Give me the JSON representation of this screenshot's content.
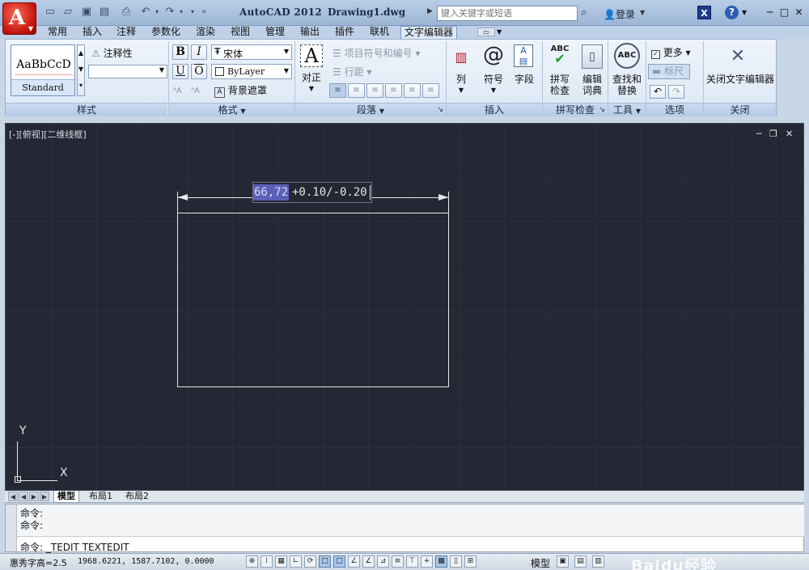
{
  "app": {
    "title": "AutoCAD 2012",
    "document": "Drawing1.dwg",
    "search_placeholder": "键入关键字或短语",
    "login_label": "登录"
  },
  "tabs": [
    {
      "label": "常用"
    },
    {
      "label": "插入"
    },
    {
      "label": "注释"
    },
    {
      "label": "参数化"
    },
    {
      "label": "渲染"
    },
    {
      "label": "视图"
    },
    {
      "label": "管理"
    },
    {
      "label": "输出"
    },
    {
      "label": "插件"
    },
    {
      "label": "联机"
    },
    {
      "label": "文字编辑器",
      "active": true
    }
  ],
  "ribbon": {
    "style": {
      "sample_text": "AaBbCcD",
      "style_name": "Standard",
      "annotative_label": "注释性",
      "height_value": "",
      "panel_title": "样式"
    },
    "format": {
      "bold": "B",
      "italic": "I",
      "underline": "U",
      "overline": "O",
      "font_value": "宋体",
      "color_value": "ByLayer",
      "mask_label": "背景遮罩",
      "panel_title": "格式"
    },
    "paragraph": {
      "justify_label": "对正",
      "bullets_label": "项目符号和编号",
      "spacing_label": "行距",
      "panel_title": "段落"
    },
    "insert": {
      "columns_label": "列",
      "symbol_label": "符号",
      "field_label": "字段",
      "panel_title": "插入"
    },
    "spell": {
      "spellcheck_label_1": "拼写",
      "spellcheck_label_2": "检查",
      "dict_label_1": "编辑",
      "dict_label_2": "词典",
      "panel_title": "拼写检查"
    },
    "tools": {
      "find_label_1": "查找和",
      "find_label_2": "替换",
      "panel_title": "工具"
    },
    "options": {
      "more_label": "更多",
      "ruler_label": "标尺",
      "panel_title": "选项"
    },
    "close": {
      "close_label": "关闭文字编辑器",
      "panel_title": "关闭"
    }
  },
  "viewport": {
    "label": "[-][俯视][二维线框]"
  },
  "dimension": {
    "selected_text": "66,72",
    "tolerance_text": "+0.10/-0.20"
  },
  "ucs": {
    "x_label": "X",
    "y_label": "Y"
  },
  "layout_tabs": [
    {
      "label": "模型",
      "active": true
    },
    {
      "label": "布局1"
    },
    {
      "label": "布局2"
    }
  ],
  "command": {
    "history": [
      "命令:",
      "命令:"
    ],
    "current": "命令: _TEDIT TEXTEDIT"
  },
  "status": {
    "text_height": "惠秀字高=2.5",
    "coordinates": "1968.6221, 1587.7102, 0.0000",
    "model_label": "模型"
  },
  "watermark": {
    "text": "Baidu经验"
  },
  "colors": {
    "canvas": "#232834",
    "selection": "#5a5fb7",
    "app_button": "#c4130b"
  }
}
